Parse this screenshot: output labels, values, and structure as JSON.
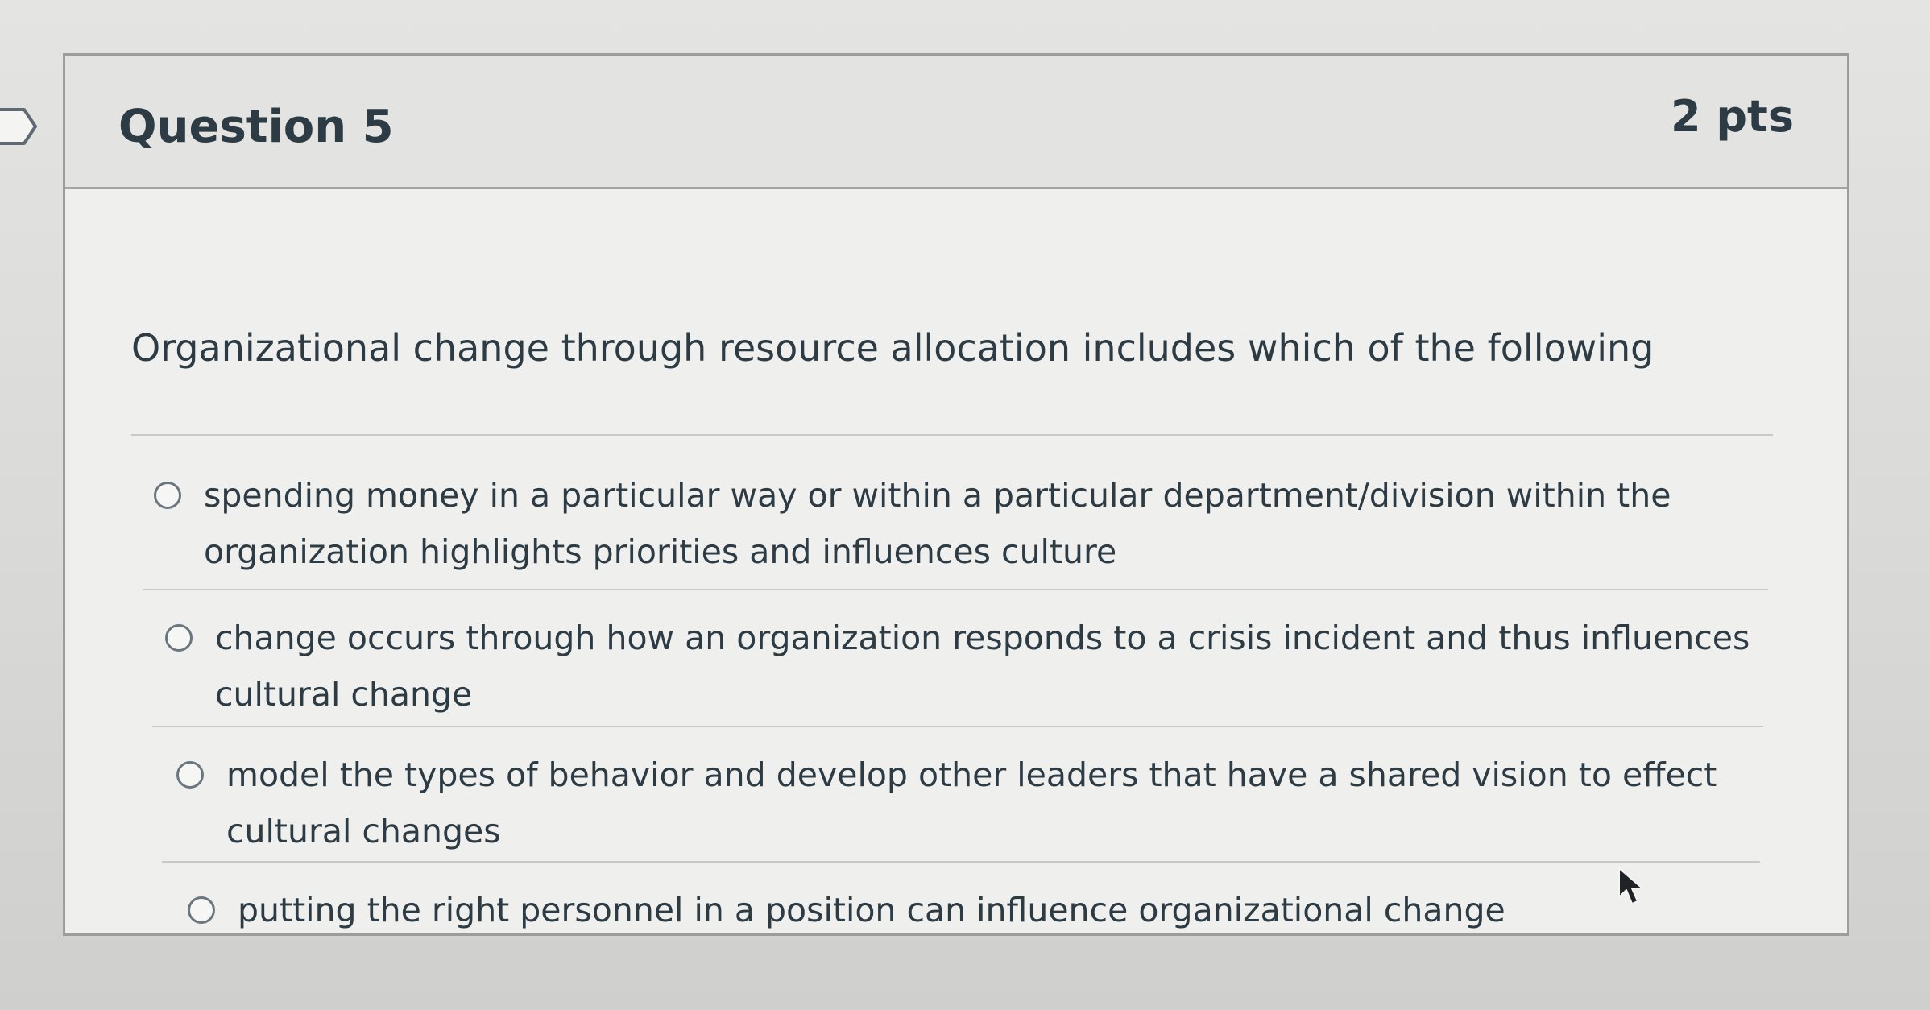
{
  "question": {
    "title": "Question 5",
    "points": "2 pts",
    "prompt": "Organizational change through resource allocation includes which of the following"
  },
  "answers": [
    {
      "label": "spending money in a particular way or within a particular department/division within the organization highlights priorities and influences culture",
      "selected": false
    },
    {
      "label": "change occurs through how an organization responds to a crisis incident and thus influences cultural change",
      "selected": false
    },
    {
      "label": "model the types of behavior and develop other leaders that have a shared vision to effect cultural changes",
      "selected": false
    },
    {
      "label": "putting the right personnel in a position can influence organizational change",
      "selected": false
    }
  ],
  "icons": {
    "flag": "bookmark-flag-icon",
    "radio": "radio-button-icon",
    "cursor": "mouse-pointer-icon"
  },
  "colors": {
    "text": "#2d3b45",
    "card_background": "#efefed",
    "header_background": "#e3e3e1",
    "border": "#9c9d9c"
  }
}
